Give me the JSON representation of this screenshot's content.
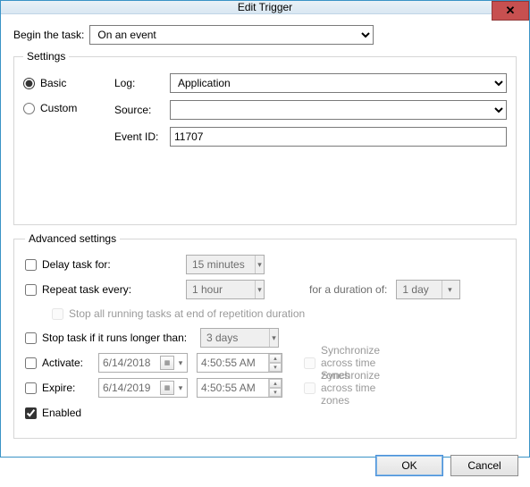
{
  "window": {
    "title": "Edit Trigger",
    "close": "✕"
  },
  "begin": {
    "label": "Begin the task:",
    "value": "On an event"
  },
  "settings": {
    "legend": "Settings",
    "basic_label": "Basic",
    "custom_label": "Custom",
    "log_label": "Log:",
    "log_value": "Application",
    "source_label": "Source:",
    "source_value": "",
    "eventid_label": "Event ID:",
    "eventid_value": "11707"
  },
  "advanced": {
    "legend": "Advanced settings",
    "delay_label": "Delay task for:",
    "delay_value": "15 minutes",
    "repeat_label": "Repeat task every:",
    "repeat_value": "1 hour",
    "duration_label": "for a duration of:",
    "duration_value": "1 day",
    "stop_all_label": "Stop all running tasks at end of repetition duration",
    "stop_if_label": "Stop task if it runs longer than:",
    "stop_if_value": "3 days",
    "activate_label": "Activate:",
    "activate_date": "6/14/2018",
    "activate_time": "4:50:55 AM",
    "expire_label": "Expire:",
    "expire_date": "6/14/2019",
    "expire_time": "4:50:55 AM",
    "sync_label": "Synchronize across time zones",
    "enabled_label": "Enabled"
  },
  "buttons": {
    "ok": "OK",
    "cancel": "Cancel"
  }
}
